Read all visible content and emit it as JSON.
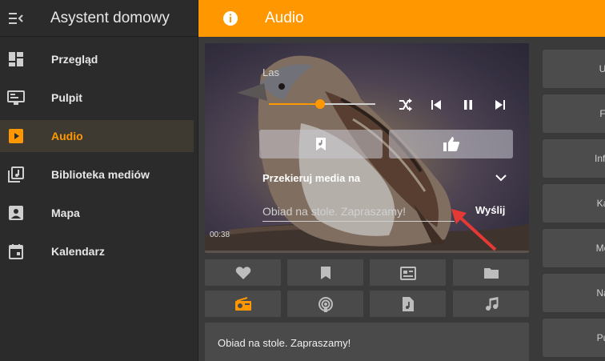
{
  "sidebar": {
    "title": "Asystent domowy",
    "items": [
      {
        "label": "Przegląd",
        "icon": "dashboard-icon",
        "active": false
      },
      {
        "label": "Pulpit",
        "icon": "monitor-icon",
        "active": false
      },
      {
        "label": "Audio",
        "icon": "play-box-icon",
        "active": true
      },
      {
        "label": "Biblioteka mediów",
        "icon": "music-library-icon",
        "active": false
      },
      {
        "label": "Mapa",
        "icon": "account-box-icon",
        "active": false
      },
      {
        "label": "Kalendarz",
        "icon": "calendar-icon",
        "active": false
      }
    ]
  },
  "topbar": {
    "title": "Audio"
  },
  "player": {
    "media_title": "Las",
    "volume": 0.48,
    "cast_label": "Przekieruj media na",
    "tts_placeholder": "Obiad na stole. Zapraszamy!",
    "send_label": "Wyślij",
    "elapsed": "00:38"
  },
  "message": {
    "text": "Obiad na stole. Zapraszamy!"
  },
  "right_column": [
    "U",
    "F",
    "Info",
    "Ka",
    "Me",
    "Na",
    "Pu",
    ""
  ],
  "colors": {
    "accent": "#ff9800",
    "sidebar": "#2b2b2b",
    "background": "#3a3a3a",
    "card": "#4a4a4a",
    "arrow": "#e53935"
  }
}
